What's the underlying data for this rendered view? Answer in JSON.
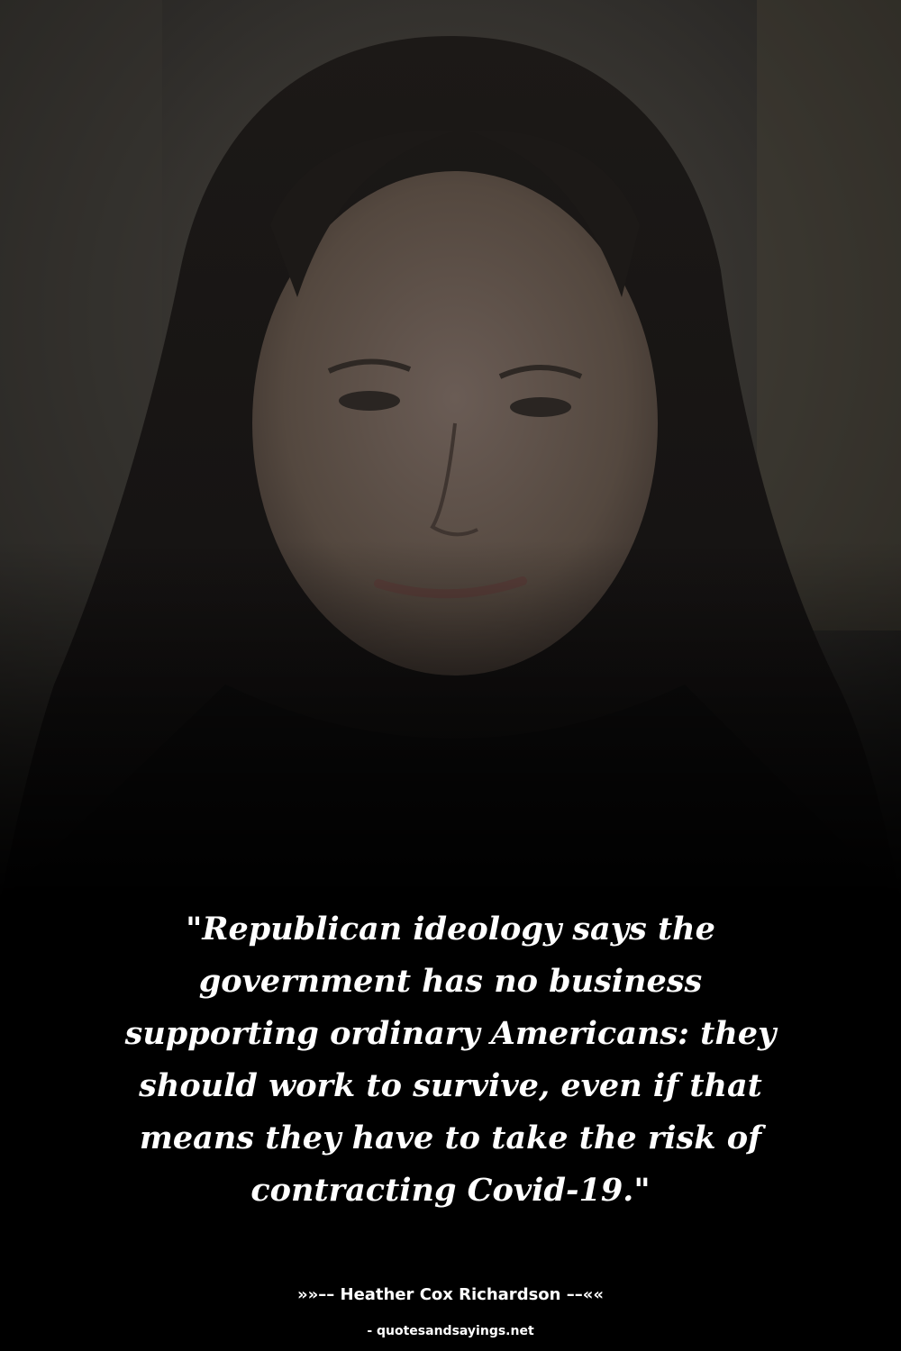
{
  "quote": {
    "lines": [
      "\"Republican ideology says the",
      "government has no business",
      "supporting ordinary Americans: they",
      "should work to survive, even if that",
      "means they have to take the risk of",
      "contracting Covid-19.\""
    ]
  },
  "attribution": {
    "author_line": "»»–– Heather Cox Richardson ––««"
  },
  "footer": {
    "source": "- quotesandsayings.net"
  },
  "colors": {
    "background": "#000000",
    "text": "#ffffff"
  }
}
